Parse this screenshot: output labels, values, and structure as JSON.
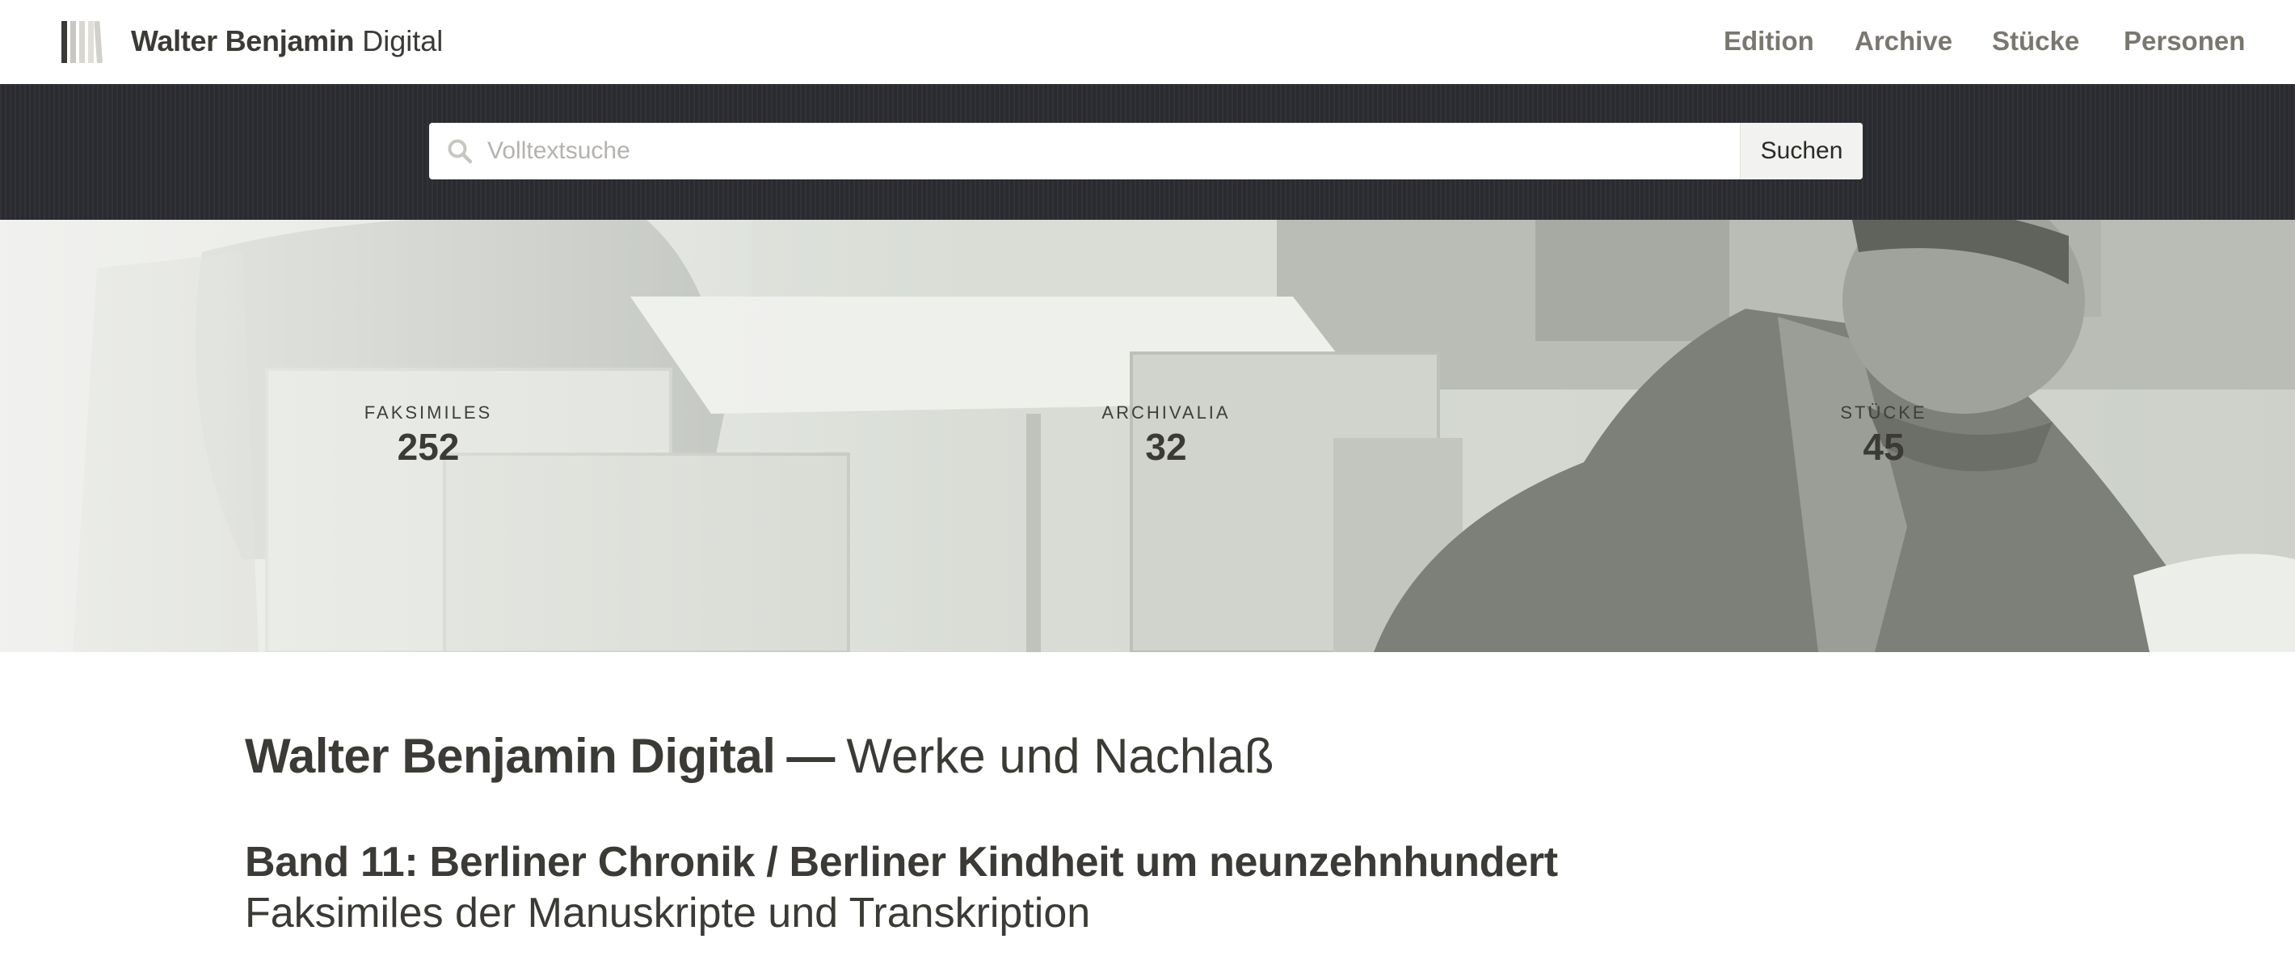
{
  "header": {
    "brand_bold": "Walter Benjamin",
    "brand_light": "Digital",
    "nav": [
      {
        "label": "Edition"
      },
      {
        "label": "Archive"
      },
      {
        "label": "Stücke"
      },
      {
        "label": "Personen"
      }
    ]
  },
  "search": {
    "placeholder": "Volltextsuche",
    "value": "",
    "button_label": "Suchen",
    "icon": "search-icon"
  },
  "stats": [
    {
      "label": "FAKSIMILES",
      "value": "252"
    },
    {
      "label": "ARCHIVALIA",
      "value": "32"
    },
    {
      "label": "STÜCKE",
      "value": "45"
    }
  ],
  "main": {
    "title_bold": "Walter Benjamin Digital",
    "title_dash": "—",
    "title_light": "Werke und Nachlaß",
    "volume_title": "Band 11: Berliner Chronik / Berliner Kindheit um neunzehnhundert",
    "volume_subtitle": "Faksimiles der Manuskripte und Transkription"
  },
  "colors": {
    "nav_text": "#7a7770",
    "search_band": "#2a2b30",
    "text": "#3b3a36"
  }
}
